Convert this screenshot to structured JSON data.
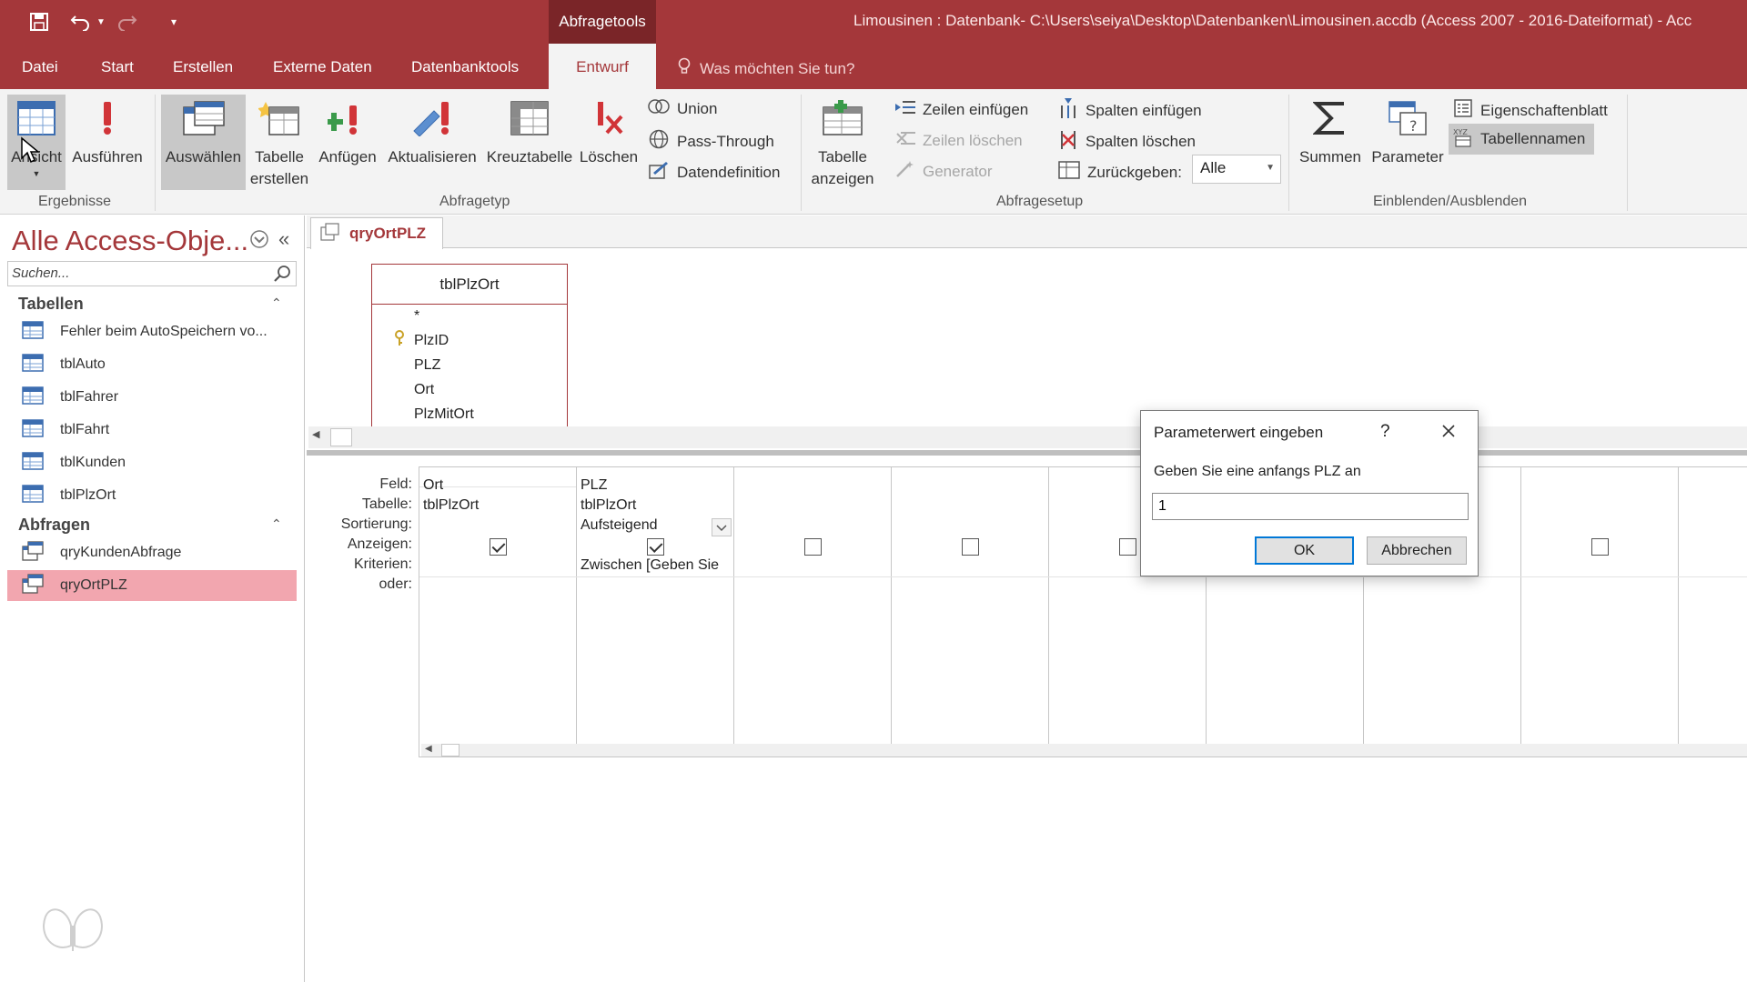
{
  "titlebar": {
    "context_tab": "Abfragetools",
    "window_title": "Limousinen : Datenbank- C:\\Users\\seiya\\Desktop\\Datenbanken\\Limousinen.accdb (Access 2007 - 2016-Dateiformat)  -  Acc"
  },
  "tabs": [
    "Datei",
    "Start",
    "Erstellen",
    "Externe Daten",
    "Datenbanktools",
    "Entwurf"
  ],
  "tell_me": "Was möchten Sie tun?",
  "ribbon": {
    "ergebnisse": {
      "label": "Ergebnisse",
      "ansicht": "Ansicht",
      "ausfuehren": "Ausführen"
    },
    "abfragetyp": {
      "label": "Abfragetyp",
      "auswaehlen": "Auswählen",
      "tabelle_erstellen_1": "Tabelle",
      "tabelle_erstellen_2": "erstellen",
      "anfuegen": "Anfügen",
      "aktualisieren": "Aktualisieren",
      "kreuztabelle": "Kreuztabelle",
      "loeschen": "Löschen",
      "union": "Union",
      "pass_through": "Pass-Through",
      "datendefinition": "Datendefinition"
    },
    "abfragesetup": {
      "label": "Abfragesetup",
      "tabelle_anzeigen_1": "Tabelle",
      "tabelle_anzeigen_2": "anzeigen",
      "zeilen_einfuegen": "Zeilen einfügen",
      "zeilen_loeschen": "Zeilen löschen",
      "generator": "Generator",
      "spalten_einfuegen": "Spalten einfügen",
      "spalten_loeschen": "Spalten löschen",
      "zurueckgeben": "Zurückgeben:",
      "zurueckgeben_value": "Alle"
    },
    "einblenden": {
      "label": "Einblenden/Ausblenden",
      "summen": "Summen",
      "parameter": "Parameter",
      "eigenschaftenblatt": "Eigenschaftenblatt",
      "tabellennamen": "Tabellennamen"
    }
  },
  "nav": {
    "title": "Alle Access-Obje...",
    "search_placeholder": "Suchen...",
    "tabellen_label": "Tabellen",
    "tabellen": [
      "Fehler beim AutoSpeichern vo...",
      "tblAuto",
      "tblFahrer",
      "tblFahrt",
      "tblKunden",
      "tblPlzOrt"
    ],
    "abfragen_label": "Abfragen",
    "abfragen": [
      "qryKundenAbfrage",
      "qryOrtPLZ"
    ]
  },
  "doc_tab": "qryOrtPLZ",
  "table_box": {
    "name": "tblPlzOrt",
    "fields": [
      "*",
      "PlzID",
      "PLZ",
      "Ort",
      "PlzMitOrt"
    ]
  },
  "grid": {
    "row_labels": [
      "Feld:",
      "Tabelle:",
      "Sortierung:",
      "Anzeigen:",
      "Kriterien:",
      "oder:"
    ],
    "columns": [
      {
        "feld": "Ort",
        "tabelle": "tblPlzOrt",
        "sortierung": "",
        "anzeigen": true,
        "kriterien": ""
      },
      {
        "feld": "PLZ",
        "tabelle": "tblPlzOrt",
        "sortierung": "Aufsteigend",
        "anzeigen": true,
        "kriterien": "Zwischen [Geben Sie"
      }
    ]
  },
  "dialog": {
    "title": "Parameterwert eingeben",
    "help": "?",
    "prompt": "Geben Sie eine anfangs PLZ an",
    "input_value": "1",
    "ok": "OK",
    "cancel": "Abbrechen"
  },
  "colors": {
    "accent": "#a4373a",
    "selected_nav": "#f2a6af"
  }
}
